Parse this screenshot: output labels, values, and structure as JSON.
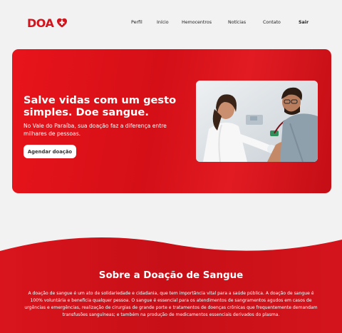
{
  "logo": {
    "text": "DOA",
    "brand_color": "#d4141c"
  },
  "nav": {
    "items": [
      {
        "label": "Perfil"
      },
      {
        "label": "Início"
      },
      {
        "label": "Hemocentros"
      },
      {
        "label": "Notícias"
      },
      {
        "label": "Contato"
      }
    ],
    "logout_label": "Sair"
  },
  "hero": {
    "title": "Salve vidas com um gesto simples. Doe sangue.",
    "subtitle": "No Vale do Paraíba, sua doação faz a diferença entre milhares de pessoas.",
    "cta_label": "Agendar doação",
    "accent_color": "#e3141c"
  },
  "about": {
    "title": "Sobre a Doação de Sangue",
    "text": "A doação de sangue é um ato de solidariedade e cidadania, que tem importância vital para a saúde pública.  A doação de sangue é 100% voluntária e beneficia qualquer pessoa. O sangue é essencial para os atendimentos de sangramentos agudos em casos de urgências e emergências, realização de cirurgias de grande porte e tratamentos de doenças crônicas que frequentemente demandam transfusões sanguíneas; e também na produção de medicamentos essenciais derivados do plasma."
  }
}
